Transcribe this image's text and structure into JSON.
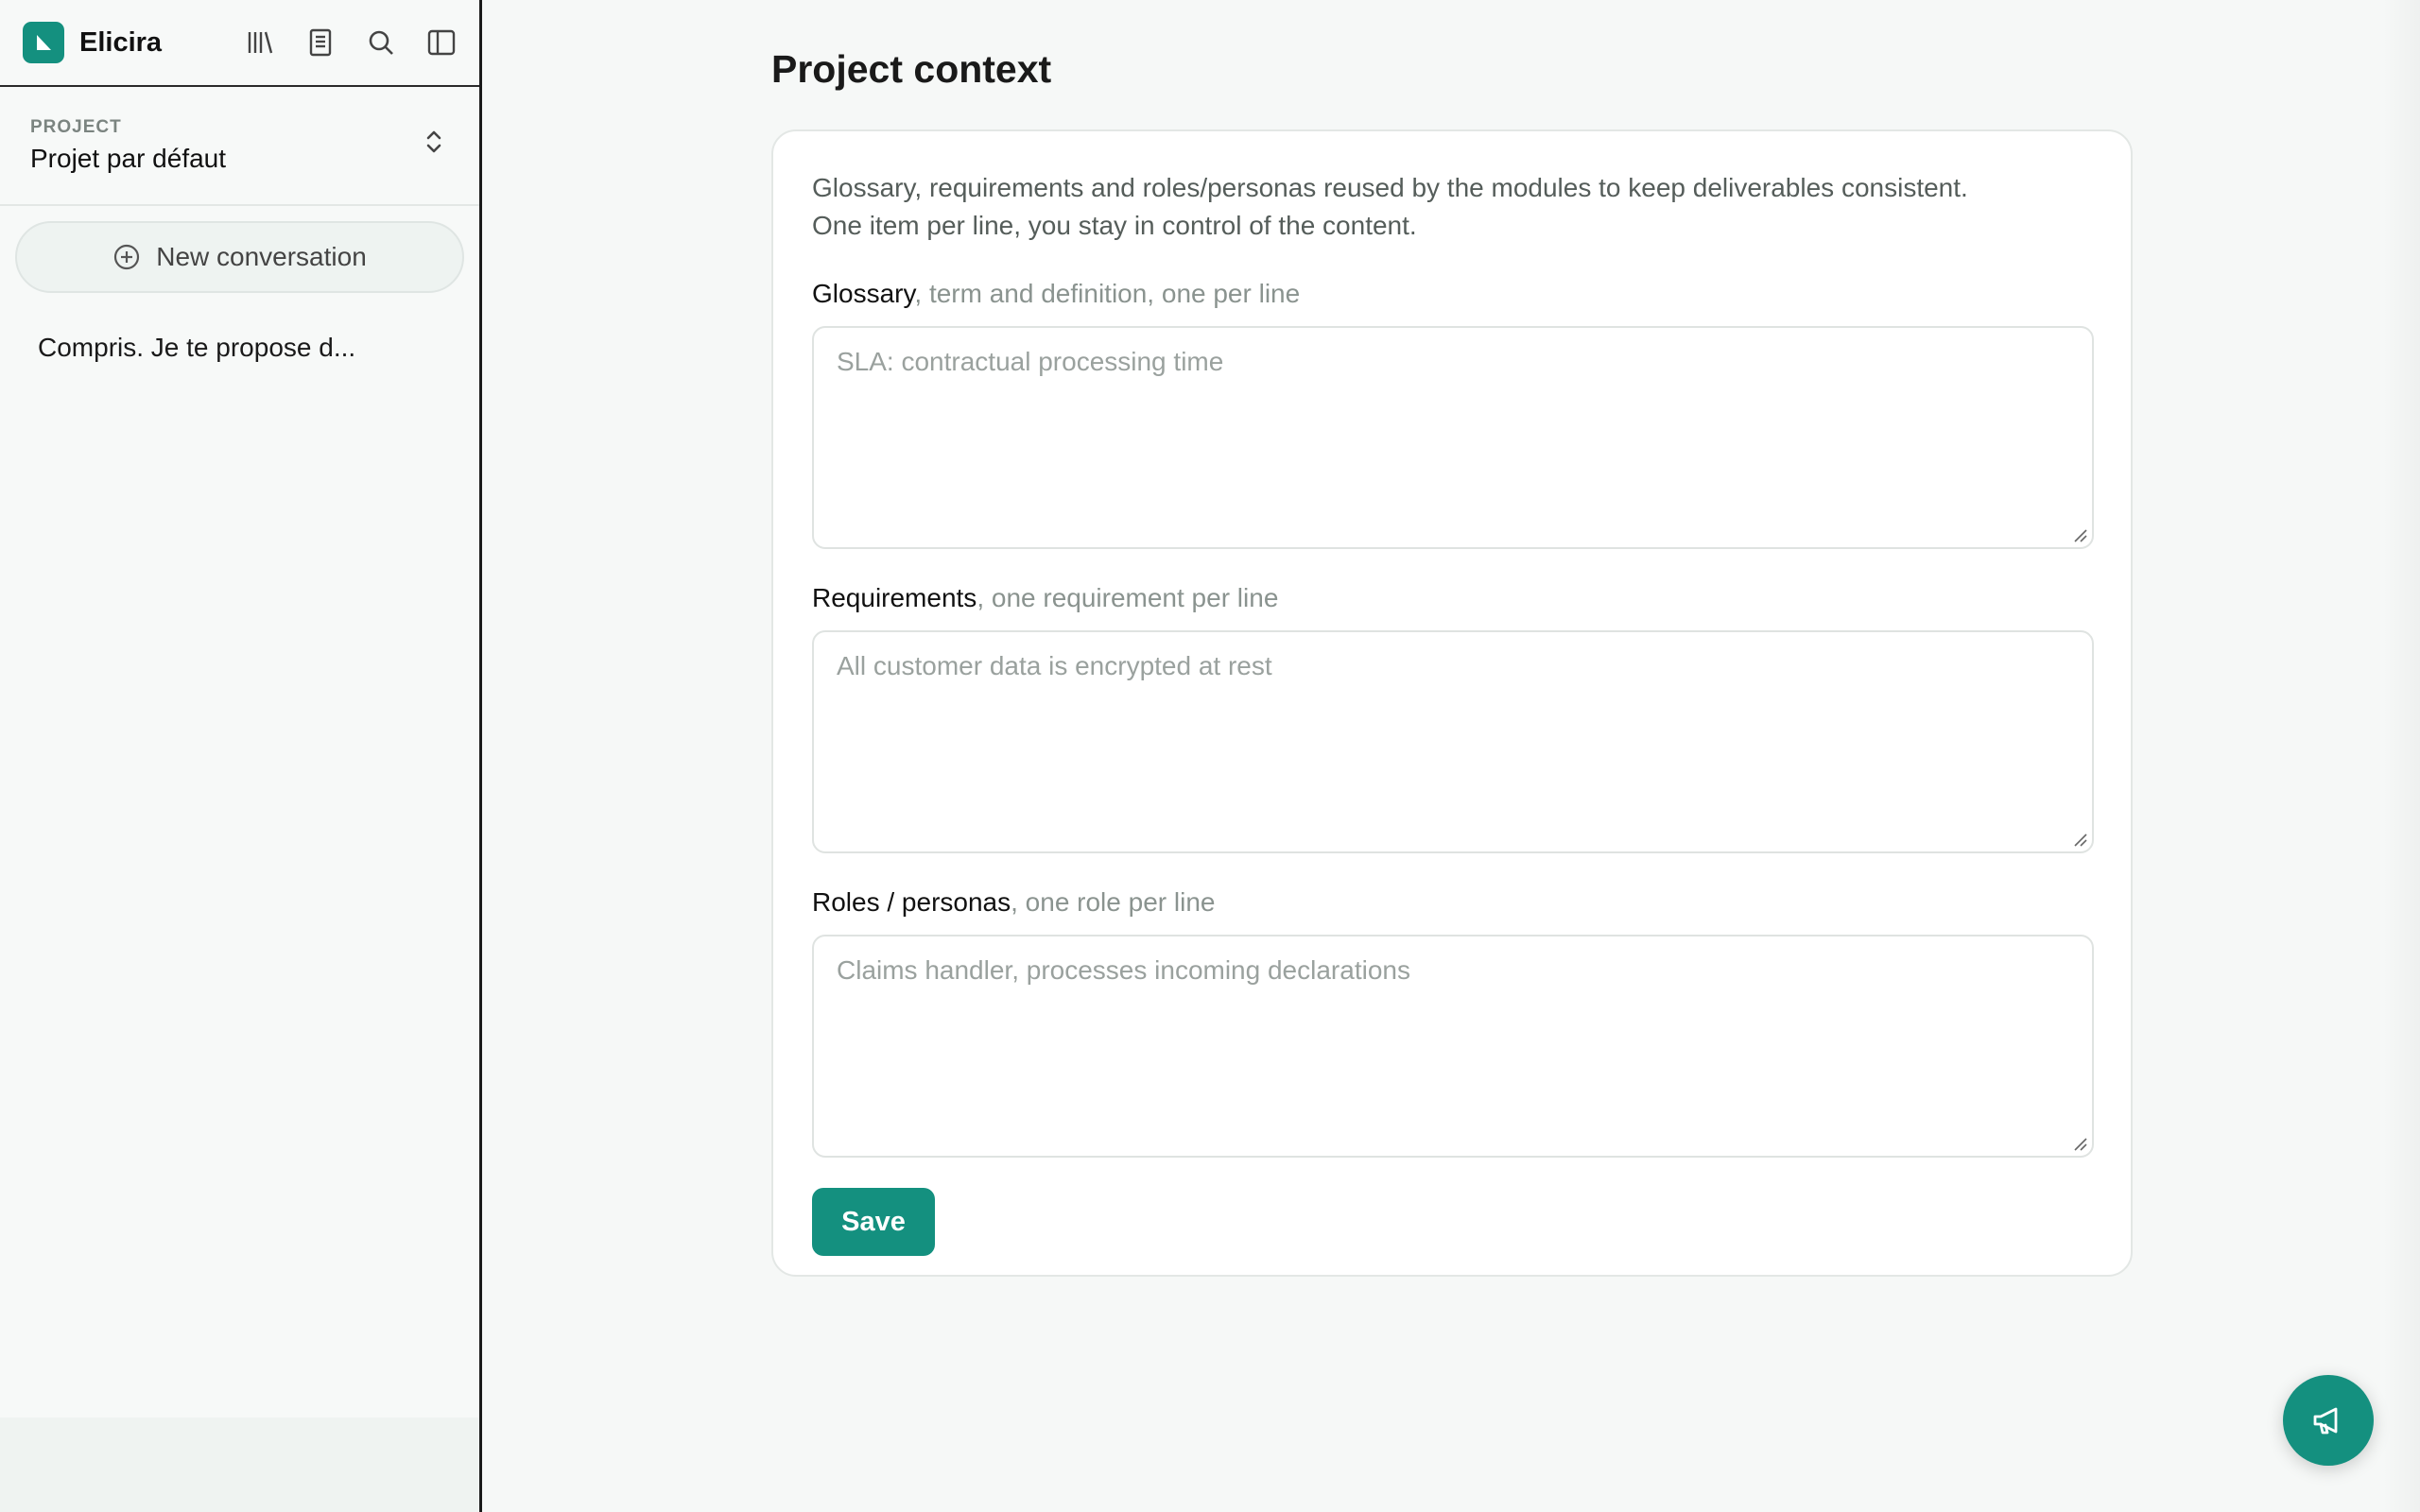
{
  "app": {
    "name": "Elicira",
    "accent": "#14907f"
  },
  "sidebar": {
    "icons": [
      "library-icon",
      "document-icon",
      "search-icon",
      "sidebar-toggle-icon"
    ],
    "project_label": "PROJECT",
    "project_name": "Projet par défaut",
    "new_conversation": "New conversation",
    "conversations": [
      "Compris. Je te propose d..."
    ]
  },
  "main": {
    "title": "Project context",
    "description_line1": "Glossary, requirements and roles/personas reused by the modules to keep deliverables consistent.",
    "description_line2": "One item per line, you stay in control of the content.",
    "fields": [
      {
        "label": "Glossary",
        "hint": ", term and definition, one per line",
        "placeholder": "SLA: contractual processing time"
      },
      {
        "label": "Requirements",
        "hint": ", one requirement per line",
        "placeholder": "All customer data is encrypted at rest"
      },
      {
        "label": "Roles / personas",
        "hint": ", one role per line",
        "placeholder": "Claims handler, processes incoming declarations"
      }
    ],
    "save_label": "Save"
  },
  "fab": {
    "icon": "megaphone-icon"
  }
}
